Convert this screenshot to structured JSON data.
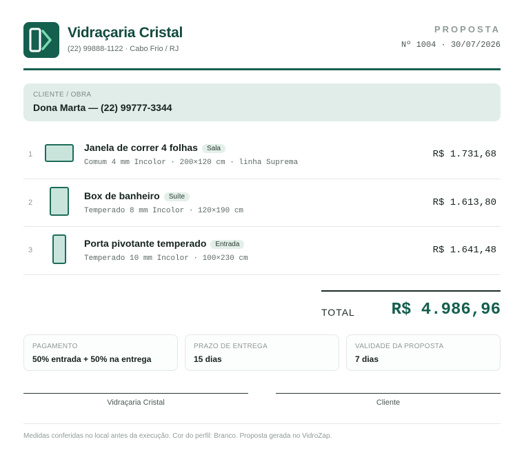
{
  "company": {
    "name": "Vidraçaria Cristal",
    "contact": "(22) 99888-1122 · Cabo Frio / RJ"
  },
  "document": {
    "type": "PROPOSTA",
    "number_date": "Nº 1004 · 30/07/2026"
  },
  "client": {
    "label": "CLIENTE / OBRA",
    "value": "Dona Marta — (22) 99777-3344"
  },
  "items": [
    {
      "number": "1",
      "title": "Janela de correr 4 folhas",
      "tag": "Sala",
      "spec": "Comum 4 mm Incolor · 200×120 cm · linha Suprema",
      "price": "R$ 1.731,68"
    },
    {
      "number": "2",
      "title": "Box de banheiro",
      "tag": "Suíte",
      "spec": "Temperado 8 mm Incolor · 120×190 cm",
      "price": "R$ 1.613,80"
    },
    {
      "number": "3",
      "title": "Porta pivotante temperado",
      "tag": "Entrada",
      "spec": "Temperado 10 mm Incolor · 100×230 cm",
      "price": "R$ 1.641,48"
    }
  ],
  "total": {
    "label": "TOTAL",
    "value": "R$ 4.986,96"
  },
  "info": [
    {
      "label": "PAGAMENTO",
      "value": "50% entrada + 50% na entrega"
    },
    {
      "label": "PRAZO DE ENTREGA",
      "value": "15 dias"
    },
    {
      "label": "VALIDADE DA PROPOSTA",
      "value": "7 dias"
    }
  ],
  "signatures": {
    "left": "Vidraçaria Cristal",
    "right": "Cliente"
  },
  "footnote": "Medidas conferidas no local antes da execução. Cor do perfil: Branco. Proposta gerada no VidroZap.",
  "colors": {
    "brand": "#155f4f",
    "accent": "#7dd9b0",
    "glass_fill": "#c9e5db"
  },
  "icons": {
    "logo": "logo-icon",
    "item_1": "window-glass-icon",
    "item_2": "shower-box-icon",
    "item_3": "pivot-door-icon"
  }
}
